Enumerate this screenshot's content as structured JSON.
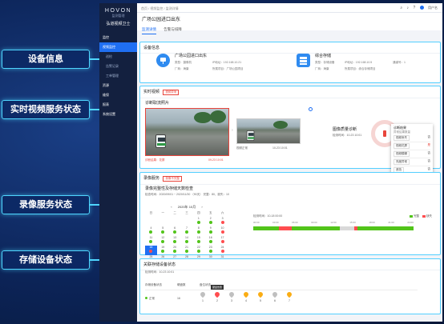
{
  "callouts": [
    "设备信息",
    "实时视频服务状态",
    "录像服务状态",
    "存储设备状态"
  ],
  "logo": {
    "mark": "HOVON",
    "sub": "监测管理",
    "name": "弘道视频卫士"
  },
  "nav": [
    {
      "label": "监控",
      "kind": "group"
    },
    {
      "label": "视频监控",
      "kind": "active"
    },
    {
      "label": "巡检",
      "kind": "child"
    },
    {
      "label": "告警记录",
      "kind": "child"
    },
    {
      "label": "工单管理",
      "kind": "child"
    },
    {
      "label": "资源",
      "kind": "group"
    },
    {
      "label": "维保",
      "kind": "group"
    },
    {
      "label": "报表",
      "kind": "group"
    },
    {
      "label": "系统设置",
      "kind": "group"
    }
  ],
  "breadcrumb": "首页 / 视频监控 / 监测详情",
  "user": "用户名",
  "page_title": "广场公园进口出东",
  "tabs": [
    "监测详情",
    "告警与排障"
  ],
  "device": {
    "title": "设备信息",
    "camera": {
      "name": "广场公园进口出东",
      "kv": [
        "类型：摄像机",
        "IP地址：192.168.10.21",
        "厂商：海康",
        "所属项目：广场公园项目"
      ]
    },
    "storage": {
      "name": "综合存储",
      "kv": [
        "类型：存储设备",
        "IP地址：192.168.10.5",
        "通道号：1",
        "厂商：海康",
        "所属项目：综合存储项目"
      ]
    }
  },
  "video": {
    "title": "实时视频",
    "tag": "视频异常",
    "shot_title": "诊断取流照片",
    "main_caption": "诊断结果：花屏",
    "main_time": "09-23 10:01",
    "small_caption": "视频正常",
    "small_time": "10-23 10:01",
    "quality_title": "图像质量诊断",
    "quality_time": "检测时间：10-23 10:01",
    "popup": {
      "title": "诊断结果",
      "sub": "异常结果数量",
      "rows": [
        [
          "视频丢失",
          "否"
        ],
        [
          "视频花屏",
          "是"
        ],
        [
          "视频模糊",
          "否"
        ],
        [
          "亮度异常",
          "否"
        ],
        [
          "遮挡",
          "否"
        ]
      ]
    }
  },
  "record": {
    "title": "录像服务",
    "tag": "录像不完整",
    "check_title": "录像完整性及存储天数检查",
    "info": "检查时间：2020/09/01 ~ 2020/11/30 （90天） 完整：80，缺失：10",
    "month": "2020年 10月",
    "weekdays": [
      "日",
      "一",
      "二",
      "三",
      "四",
      "五",
      "六"
    ],
    "days": [
      "",
      "",
      "",
      "",
      "1",
      "2",
      "3",
      "4",
      "5",
      "6",
      "7",
      "8",
      "9",
      "10",
      "11",
      "12",
      "13",
      "14",
      "15",
      "16",
      "17",
      "18",
      "19",
      "20",
      "21",
      "22",
      "23",
      "24",
      "25",
      "26",
      "27",
      "28",
      "29",
      "30",
      "31",
      "",
      "",
      "",
      "",
      "",
      "",
      ""
    ],
    "selected_day": "18",
    "legend": [
      "完整",
      "缺失"
    ],
    "timeline_label": "检测时间：10-18 00:00",
    "hours": [
      "00:00",
      "03:00",
      "06:00",
      "09:00",
      "12:00",
      "15:00",
      "18:00",
      "21:00",
      "24:00"
    ]
  },
  "storage": {
    "title": "关联存储设备状态",
    "sub": "检测时间：10-23 10:01",
    "headers": [
      "存储设备状态",
      "硬盘数",
      "盘位状态"
    ],
    "status": "正常",
    "disk_count": "16",
    "tooltip": "硬盘告警",
    "slots": [
      "1",
      "2",
      "3",
      "4",
      "5",
      "6",
      "7"
    ]
  },
  "colors": {
    "accent": "#1f6ff2",
    "ok": "#52c41a",
    "bad": "#ff4d4f",
    "callout": "#4fd6ff"
  }
}
